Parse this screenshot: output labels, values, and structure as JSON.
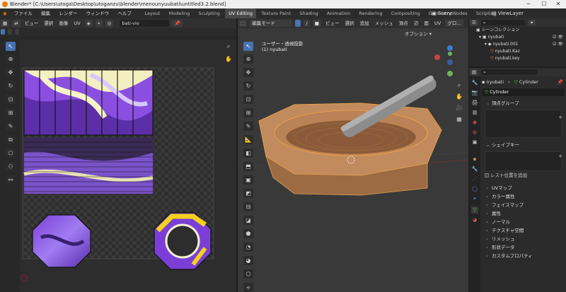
{
  "window": {
    "title": "Blender* [C:\\Users\\utoga\\Desktop\\utoganzu\\blender\\menounyuubati\\untitled3.2.blend]",
    "min": "─",
    "max": "☐",
    "close": "✕"
  },
  "menu": [
    "ファイル",
    "編集",
    "レンダー",
    "ウィンドウ",
    "ヘルプ"
  ],
  "workspaces": [
    "Layout",
    "Modeling",
    "Sculpting",
    "UV Editing",
    "Texture Paint",
    "Shading",
    "Animation",
    "Rendering",
    "Compositing",
    "Geometry Nodes",
    "Scripting"
  ],
  "active_workspace": "UV Editing",
  "scene": "Scene",
  "view_layer": "ViewLayer",
  "uv_editor": {
    "header": [
      "ビュー",
      "選択",
      "画像",
      "UV"
    ],
    "image_name": "bati-vio"
  },
  "viewport": {
    "mode": "編集モード",
    "header": [
      "ビュー",
      "選択",
      "追加",
      "メッシュ",
      "頂点",
      "辺",
      "面",
      "UV"
    ],
    "transform": "グロ...",
    "options": "オプション",
    "view_name": "ユーザー・透視投影",
    "object_name": "(1) nyubati"
  },
  "outliner": {
    "title": "シーンコレクション",
    "rows": [
      "nyubati",
      "nyubati.001",
      "nyubati.Kaz",
      "nyubati.key"
    ]
  },
  "properties": {
    "object": "nyubati",
    "mesh": "Cylinder",
    "data_name": "Cylinder",
    "vertex_groups": "頂点グループ",
    "shape_keys": "シェイプキー",
    "rest_position": "レスト位置を追加",
    "panels": [
      "UVマップ",
      "カラー属性",
      "フェイスマップ",
      "属性",
      "ノーマル",
      "テクスチャ空間",
      "リメッシュ",
      "形状データ",
      "カスタムプロパティ"
    ]
  }
}
